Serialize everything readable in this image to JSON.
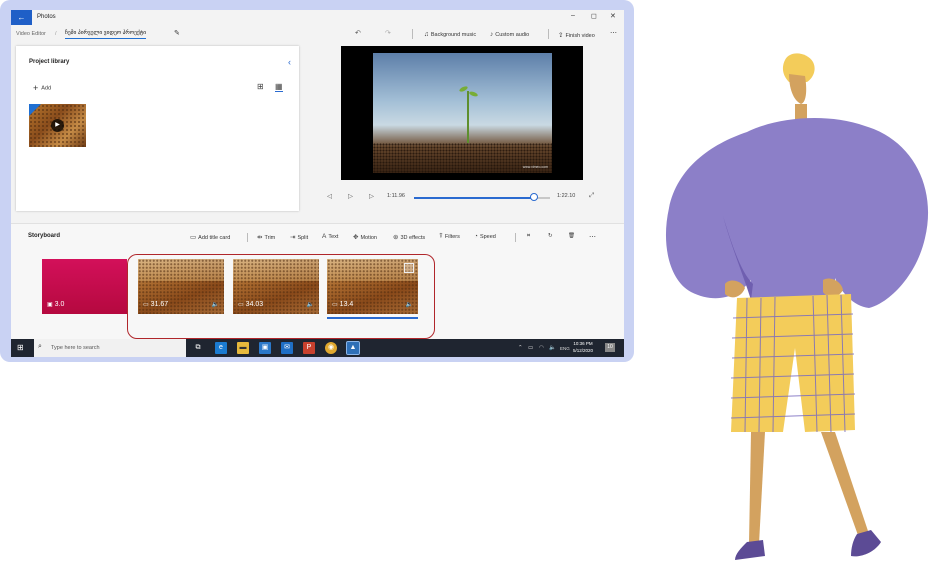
{
  "window": {
    "app_title": "Photos",
    "controls": {
      "minimize": "–",
      "maximize": "◻",
      "close": "✕"
    }
  },
  "toolbar": {
    "breadcrumb": "Video Editor",
    "separator": "/",
    "project_name": "ჩემი პირველი ვიდეო პროექტი",
    "undo": "↶",
    "redo": "↷",
    "background_music": "Background music",
    "custom_audio": "Custom audio",
    "finish_video": "Finish video",
    "more": "⋯"
  },
  "library": {
    "title": "Project library",
    "add_label": "Add",
    "collapse_icon": "‹"
  },
  "preview": {
    "watermark": "www.vimeo.com",
    "current_time": "1:11.96",
    "total_time": "1:22.10",
    "progress": 0.88
  },
  "storyboard": {
    "title": "Storyboard",
    "tools": {
      "add_title_card": "Add title card",
      "trim": "Trim",
      "split": "Split",
      "text": "Text",
      "motion": "Motion",
      "effects_3d": "3D effects",
      "filters": "Filters",
      "speed": "Speed",
      "more": "⋯"
    },
    "clips": [
      {
        "type": "title-card",
        "duration": "3.0",
        "color": "#c8084a"
      },
      {
        "type": "video",
        "duration": "31.67"
      },
      {
        "type": "video",
        "duration": "34.03"
      },
      {
        "type": "video",
        "duration": "13.4",
        "selected": true
      }
    ]
  },
  "taskbar": {
    "search_placeholder": "Type here to search",
    "language": "ENG",
    "time": "10:36 PM",
    "date": "5/12/2020",
    "notification_count": "10"
  },
  "colors": {
    "accent": "#2a6ad0",
    "frame": "#c9d2f3",
    "highlight_border": "#b0262b",
    "figure_sweater": "#8c7fc8",
    "figure_pants": "#f3cc5a",
    "figure_skin": "#d3a25f",
    "figure_shoes": "#5c4b95"
  }
}
